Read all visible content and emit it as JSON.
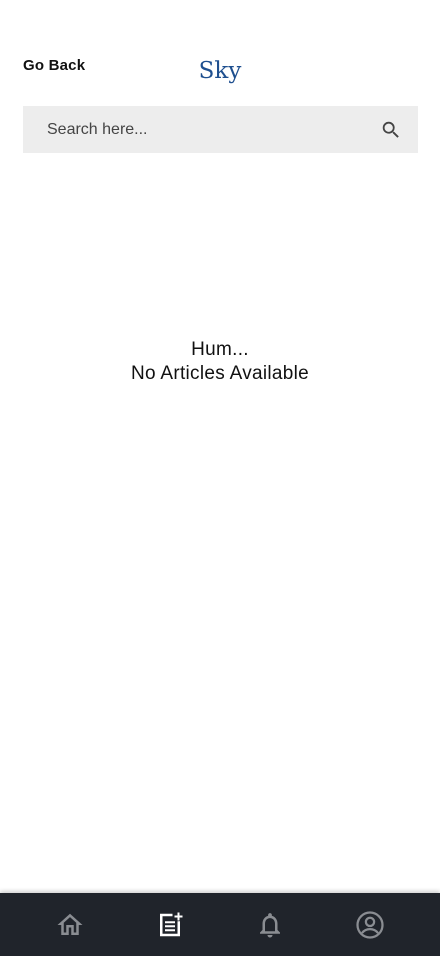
{
  "header": {
    "back_label": "Go Back",
    "title": "Sky"
  },
  "search": {
    "placeholder": "Search here...",
    "value": "",
    "icon": "search-icon"
  },
  "empty_state": {
    "line1": "Hum...",
    "line2": "No Articles Available"
  },
  "bottom_nav": {
    "items": [
      {
        "icon": "home-icon",
        "active": false
      },
      {
        "icon": "articles-icon",
        "active": true
      },
      {
        "icon": "bell-icon",
        "active": false
      },
      {
        "icon": "profile-icon",
        "active": false
      }
    ]
  },
  "colors": {
    "title": "#1e4f8f",
    "nav_background": "#20242b",
    "nav_icon_active": "#ffffff",
    "nav_icon_inactive": "#8a8d92",
    "search_background": "#ededed"
  }
}
